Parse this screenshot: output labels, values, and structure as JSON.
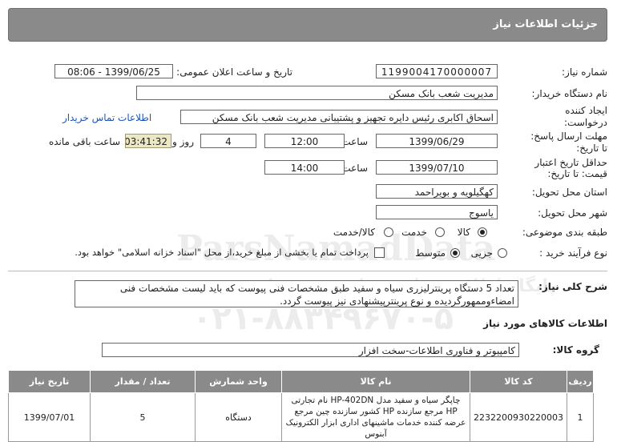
{
  "header": {
    "title": "جزئیات اطلاعات نیاز"
  },
  "fields": {
    "need_number_label": "شماره نیاز:",
    "need_number": "1199004170000007",
    "announce_label": "تاریخ و ساعت اعلان عمومی:",
    "announce_value": "1399/06/25 - 08:06",
    "buyer_label": "نام دستگاه خریدار:",
    "buyer_value": "مدیریت شعب بانک مسکن",
    "creator_label_1": "ایجاد کننده",
    "creator_label_2": "درخواست:",
    "creator_value": "اسحاق اکابری رئیس دایره تجهیز و پشتیبانی مدیریت شعب بانک مسکن",
    "contact_link": "اطلاعات تماس خریدار",
    "deadline_label_1": "مهلت ارسال پاسخ:",
    "deadline_label_2": "تا تاریخ:",
    "deadline_date": "1399/06/29",
    "time_label": "ساعت",
    "deadline_time": "12:00",
    "days_value": "4",
    "days_label": "روز و",
    "remaining_time": "03:41:32",
    "remaining_label": "ساعت باقی مانده",
    "validity_label_1": "حداقل تاریخ اعتبار",
    "validity_label_2": "قیمت: تا تاریخ:",
    "validity_date": "1399/07/10",
    "validity_time": "14:00",
    "province_label": "استان محل تحویل:",
    "province_value": "کهگیلویه و بویراحمد",
    "city_label": "شهر محل تحویل:",
    "city_value": "یاسوج",
    "category_label": "طبقه بندی موضوعی:",
    "category_options": [
      "کالا",
      "خدمت",
      "کالا/خدمت"
    ],
    "process_label": "نوع فرآیند خرید :",
    "process_options": [
      "جزیی",
      "متوسط"
    ],
    "payment_note": "پرداخت تمام یا بخشی از مبلغ خرید،از محل \"اسناد خزانه اسلامی\" خواهد بود.",
    "description_label": "شرح کلی نیاز:",
    "description_value": "تعداد 5 دستگاه پرینترلیزری سیاه و سفید طبق مشخصات فنی پیوست که باید لیست مشخصات فنی امضاءوممهورگردیده و نوع پرینترپیشنهادی نیز پیوست گردد.",
    "goods_info_title": "اطلاعات کالاهای مورد نیاز",
    "goods_group_label": "گروه کالا:",
    "goods_group_value": "کامپیوتر و فناوری اطلاعات-سخت افزار"
  },
  "table": {
    "headers": [
      "ردیف",
      "کد کالا",
      "نام کالا",
      "واحد شمارش",
      "تعداد / مقدار",
      "تاریخ نیاز"
    ],
    "rows": [
      {
        "row": "1",
        "code": "2232200930220003",
        "name": "چاپگر سیاه و سفید مدل HP-402DN نام تجارتی HP مرجع سازنده HP کشور سازنده چین مرجع عرضه کننده خدمات ماشینهای اداری ابزار الکترونیک آبنوس",
        "unit": "دستگاه",
        "qty": "5",
        "date": "1399/07/01"
      }
    ]
  },
  "watermark": {
    "line1": "ParsNamadData",
    "line2": "پایگاه اطلاع رسانی مناقصه و مزایده",
    "line3": "۰۲۱-۸۸۳۴۹۶۷۰-۵"
  },
  "colors": {
    "header_bg": "#8a8a8a",
    "timer_bg": "#ede8c4",
    "link": "#1a55b8"
  }
}
